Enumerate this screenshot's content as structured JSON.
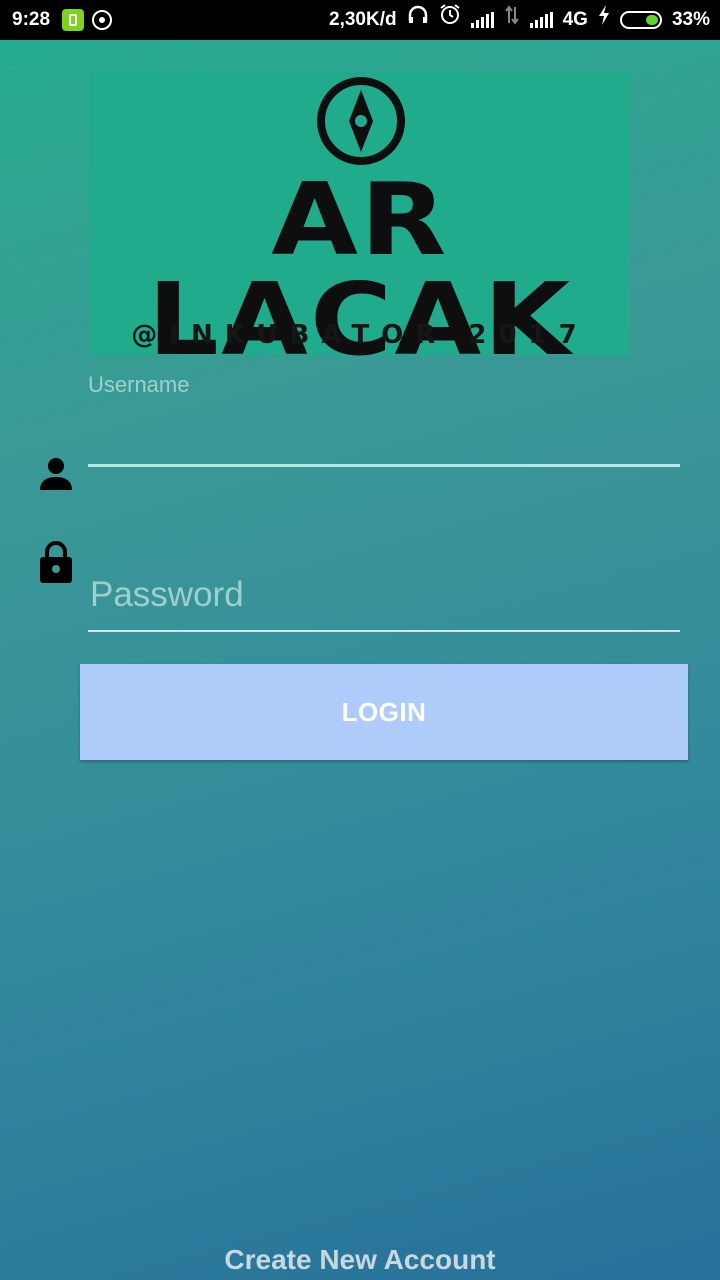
{
  "status_bar": {
    "time": "9:28",
    "network_speed": "2,30K/d",
    "network_type": "4G",
    "battery_percent": "33%",
    "battery_level": 0.33,
    "icons": [
      "phone-notification-icon",
      "whatsapp-icon",
      "headset-icon",
      "alarm-icon",
      "signal-icon",
      "data-arrows-icon",
      "signal-icon",
      "charging-icon",
      "battery-icon"
    ]
  },
  "logo": {
    "title": "AR LACAK",
    "subtitle": "@INKUBATOR 2017",
    "icon": "compass-icon",
    "background": "#20ac8c"
  },
  "form": {
    "username_label": "Username",
    "username_value": "",
    "password_placeholder": "Password",
    "password_value": "",
    "user_icon": "user-icon",
    "lock_icon": "lock-icon"
  },
  "login_button": {
    "label": "LOGIN",
    "color": "#aecbfa"
  },
  "create_account_label": "Create New Account",
  "colors": {
    "gradient_start": "#24ae8f",
    "gradient_end": "#27719b"
  }
}
